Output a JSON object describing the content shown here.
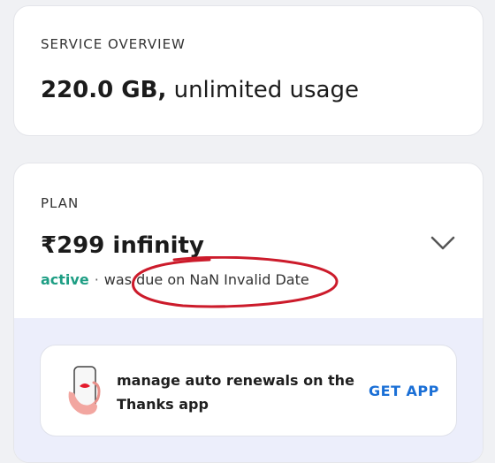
{
  "overview": {
    "label": "SERVICE OVERVIEW",
    "data_amount": "220.0 GB,",
    "data_suffix": " unlimited usage"
  },
  "plan": {
    "label": "PLAN",
    "title": "₹299 infinity",
    "status": "active",
    "separator": "·",
    "due_text": "was due on NaN Invalid Date",
    "expand_icon": "chevron-down-icon"
  },
  "promo": {
    "icon": "phone-in-hand-icon",
    "text": "manage auto renewals on the Thanks app",
    "cta": "GET APP"
  },
  "colors": {
    "active": "#1e9e84",
    "cta": "#1a6fd6",
    "annotation": "#cc1b2b"
  }
}
